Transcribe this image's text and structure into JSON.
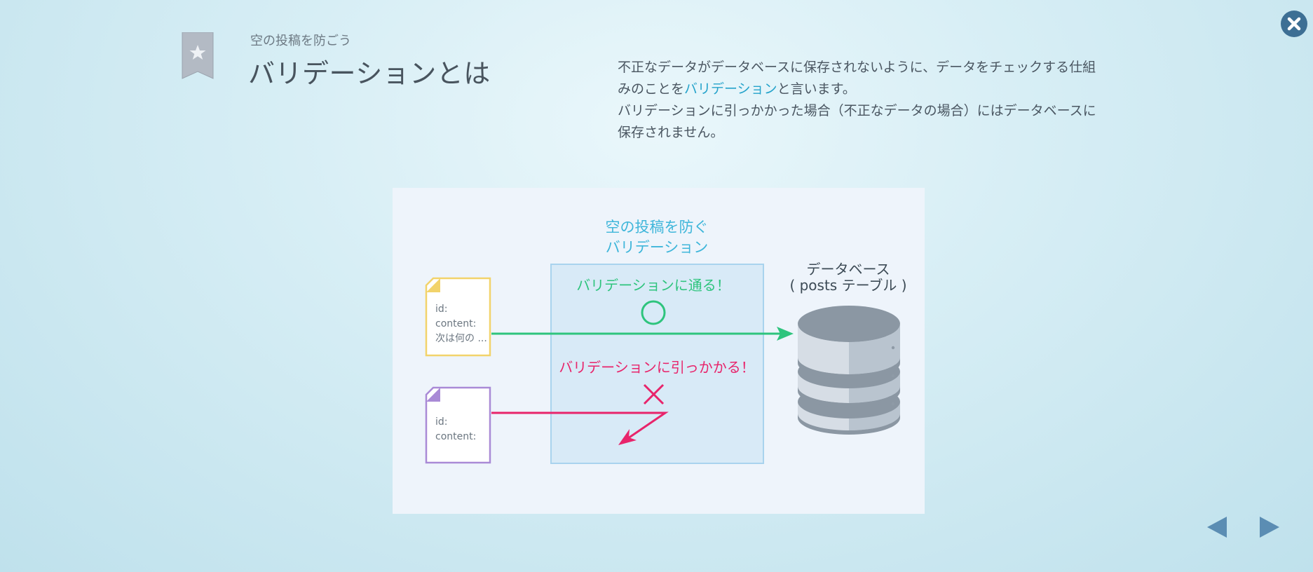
{
  "header": {
    "subtitle": "空の投稿を防ごう",
    "title": "バリデーションとは"
  },
  "description": {
    "line1_part1": "不正なデータがデータベースに保存されないように、データをチェックする仕組みのことを",
    "line1_highlight": "バリデーション",
    "line1_part2": "と言います。",
    "line2": "バリデーションに引っかかった場合（不正なデータの場合）にはデータベースに保存されません。"
  },
  "diagram": {
    "validation_title_line1": "空の投稿を防ぐ",
    "validation_title_line2": "バリデーション",
    "pass_label": "バリデーションに通る！",
    "fail_label": "バリデーションに引っかかる！",
    "db_label_line1": "データベース",
    "db_label_line2": "( posts テーブル )",
    "doc_valid": {
      "line1": "id:",
      "line2": "content:",
      "line3": "次は何の ..."
    },
    "doc_invalid": {
      "line1": "id:",
      "line2": "content:"
    }
  },
  "icons": {
    "close": "close-icon",
    "bookmark": "bookmark-star-icon",
    "prev": "prev-arrow-icon",
    "next": "next-arrow-icon",
    "pass": "circle-icon",
    "fail": "cross-icon",
    "database": "database-icon"
  },
  "colors": {
    "accent_blue": "#25a3cb",
    "pass_green": "#2ec47d",
    "fail_pink": "#e8246b",
    "doc_yellow": "#f2d36b",
    "doc_purple": "#a98ad6",
    "nav_arrow": "#5b8db3",
    "close_bg": "#3d6f94"
  }
}
